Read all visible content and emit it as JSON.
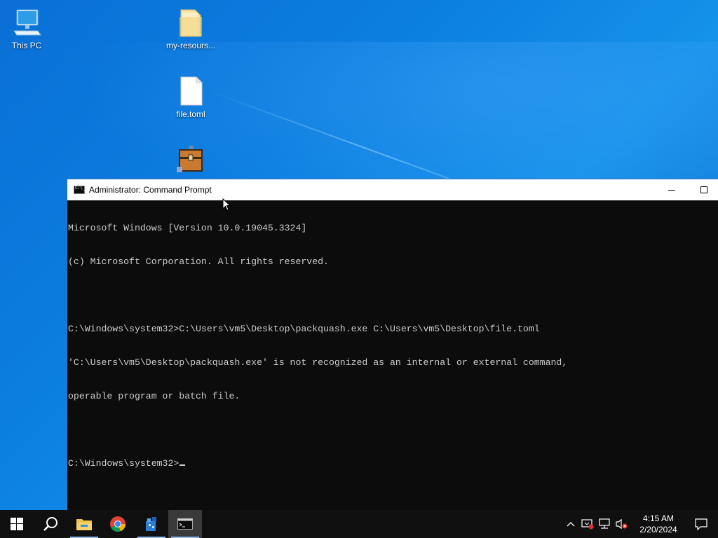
{
  "desktop": {
    "icons": [
      {
        "label": "This PC",
        "icon": "computer-icon"
      },
      {
        "label": "my-resours...",
        "icon": "folder-icon"
      },
      {
        "label": "file.toml",
        "icon": "document-icon"
      },
      {
        "label": "",
        "icon": "packquash-chest-icon"
      }
    ]
  },
  "window": {
    "title": "Administrator: Command Prompt",
    "console_lines": [
      "Microsoft Windows [Version 10.0.19045.3324]",
      "(c) Microsoft Corporation. All rights reserved.",
      "",
      "C:\\Windows\\system32>C:\\Users\\vm5\\Desktop\\packquash.exe C:\\Users\\vm5\\Desktop\\file.toml",
      "'C:\\Users\\vm5\\Desktop\\packquash.exe' is not recognized as an internal or external command,",
      "operable program or batch file.",
      "",
      "C:\\Windows\\system32>"
    ]
  },
  "taskbar": {
    "apps": [
      {
        "name": "start",
        "icon": "windows-start-icon"
      },
      {
        "name": "search",
        "icon": "search-icon"
      },
      {
        "name": "file-explorer",
        "icon": "file-explorer-icon"
      },
      {
        "name": "chrome",
        "icon": "chrome-icon"
      },
      {
        "name": "app",
        "icon": "blue-app-icon"
      },
      {
        "name": "command-prompt",
        "icon": "cmd-icon"
      }
    ],
    "clock": {
      "time": "4:15 AM",
      "date": "2/20/2024"
    }
  },
  "colors": {
    "console_bg": "#0c0c0c",
    "console_text": "#cccccc",
    "taskbar_bg": "#101010",
    "desktop_blue": "#0b7fe0"
  }
}
